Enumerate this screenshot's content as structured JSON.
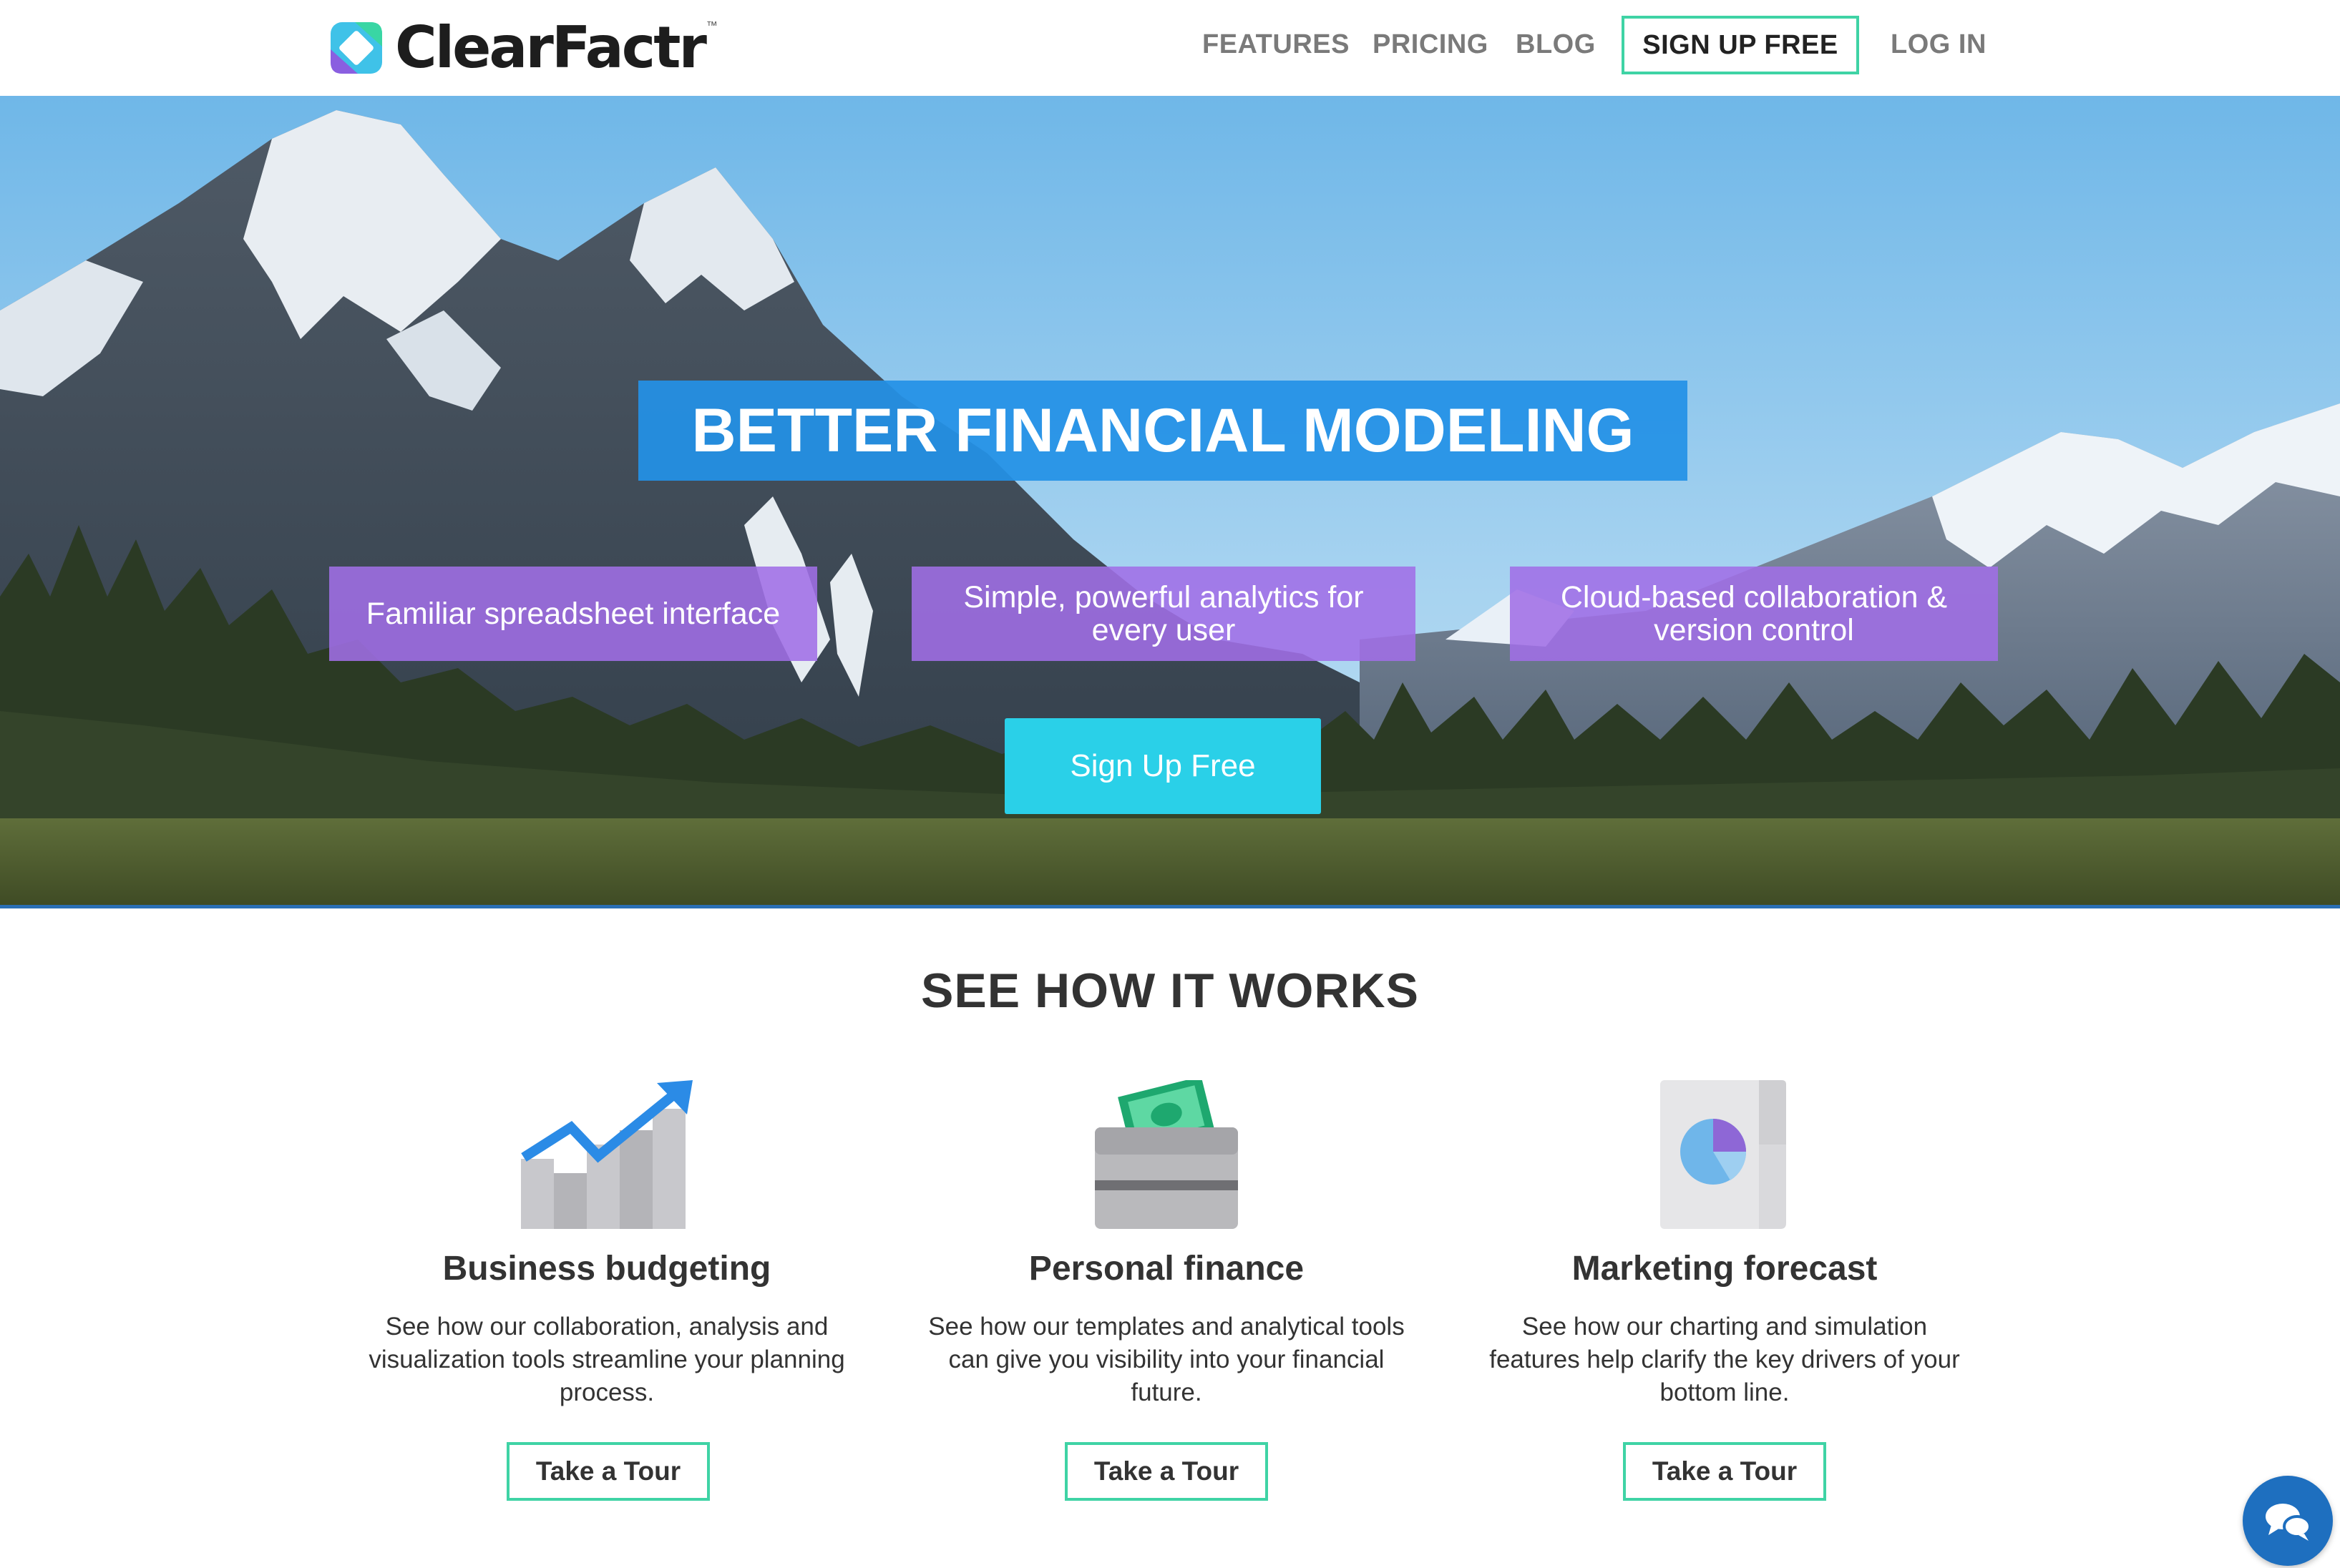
{
  "brand": {
    "name": "ClearFactr",
    "trademark": "™"
  },
  "nav": {
    "features": "FEATURES",
    "pricing": "PRICING",
    "blog": "BLOG",
    "signup": "SIGN UP FREE",
    "login": "LOG IN"
  },
  "hero": {
    "headline": "BETTER FINANCIAL MODELING",
    "features": [
      "Familiar spreadsheet interface",
      "Simple, powerful analytics for every user",
      "Cloud-based collaboration & version control"
    ],
    "cta": "Sign Up Free"
  },
  "how_it_works": {
    "title": "SEE HOW IT WORKS",
    "cards": [
      {
        "icon": "growth-chart-icon",
        "title": "Business budgeting",
        "description": "See how our collaboration, analysis and visualization tools streamline your planning process.",
        "button": "Take a Tour"
      },
      {
        "icon": "wallet-icon",
        "title": "Personal finance",
        "description": "See how our templates and analytical tools can give you visibility into your financial future.",
        "button": "Take a Tour"
      },
      {
        "icon": "pie-chart-document-icon",
        "title": "Marketing forecast",
        "description": "See how our charting and simulation features help clarify the key drivers of your bottom line.",
        "button": "Take a Tour"
      }
    ]
  },
  "colors": {
    "accent_green": "#3fd3a5",
    "headline_blue": "#2391e6",
    "feature_purple": "#a06ee6",
    "cta_cyan": "#2ad0e8",
    "chat_blue": "#1e6fbf"
  }
}
